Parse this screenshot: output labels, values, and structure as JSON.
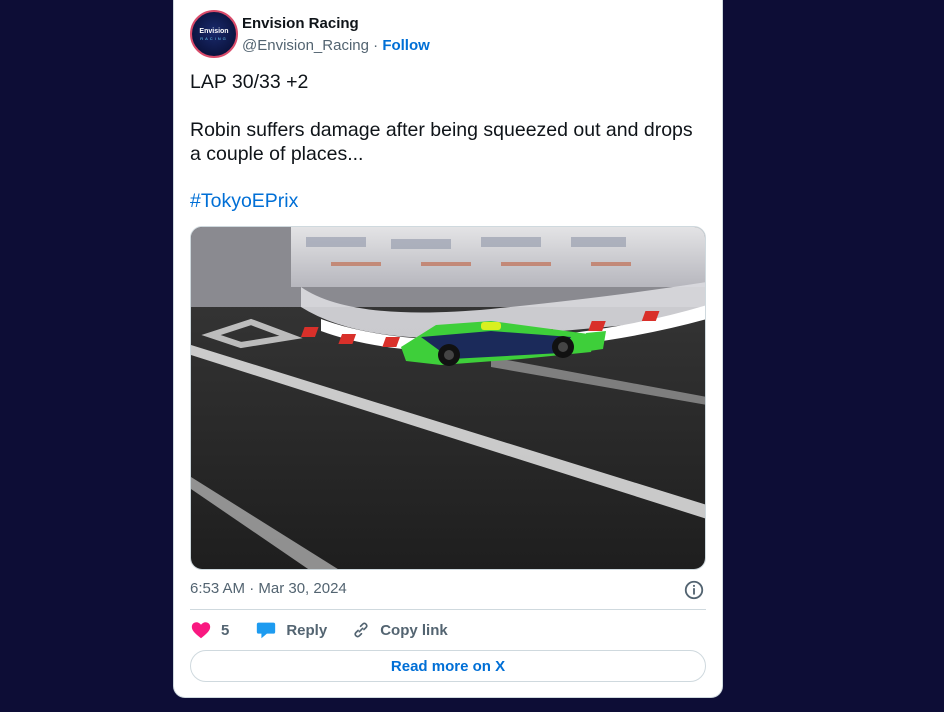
{
  "tweet": {
    "author_name": "Envision Racing",
    "handle": "@Envision_Racing",
    "separator": "·",
    "follow_label": "Follow",
    "avatar_text": "Envision",
    "avatar_subtext": "RACING",
    "text_line1": "LAP 30/33 +2",
    "text_line2": "Robin suffers damage after being squeezed out and drops a couple of places...",
    "hashtag": "#TokyoEPrix",
    "timestamp": "6:53 AM · Mar 30, 2024",
    "likes": "5",
    "reply_label": "Reply",
    "copy_link_label": "Copy link",
    "read_more_label": "Read more on X"
  },
  "colors": {
    "background": "#0d0d36",
    "link": "#006fd6",
    "heart": "#f91880",
    "reply_icon": "#1d9bf0"
  },
  "icons": [
    "info-icon",
    "heart-icon",
    "reply-bubble-icon",
    "link-icon"
  ]
}
